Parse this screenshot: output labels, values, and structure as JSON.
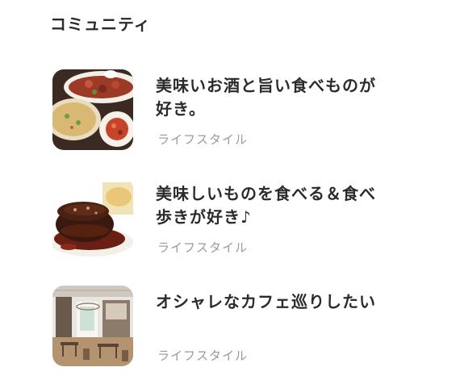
{
  "section": {
    "title": "コミュニティ"
  },
  "communities": [
    {
      "title": "美味いお酒と旨い食べものが好き。",
      "category": "ライフスタイル",
      "image": "food-platter-photo"
    },
    {
      "title": "美味しいものを食べる＆食べ歩きが好き♪",
      "category": "ライフスタイル",
      "image": "hamburg-steak-photo"
    },
    {
      "title": "オシャレなカフェ巡りしたい",
      "category": "ライフスタイル",
      "image": "cafe-interior-photo"
    }
  ]
}
